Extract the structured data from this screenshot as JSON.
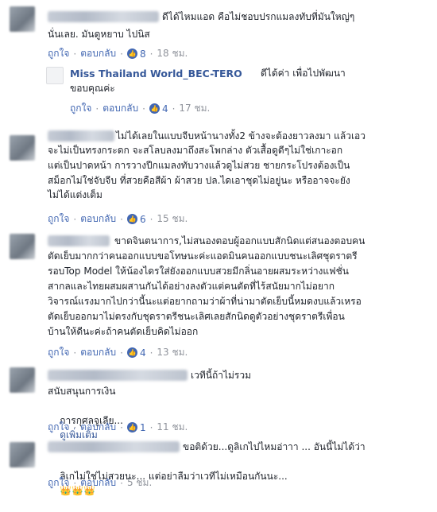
{
  "comments": [
    {
      "text_l1": "ดีได้ไหมแอด คือไม่ชอบปรกแมลงทับที่มันใหญ่ๆ",
      "text_l2": "นั่นเลย. มันดูหยาบ ไปนิส",
      "like": "ถูกใจ",
      "reply": "ตอบกลับ",
      "count": "8",
      "time": "18 ชม."
    },
    {
      "name": "Miss Thailand World_BEC-TERO",
      "text_l1": "ดีได้ค่า เพื่อไปพัฒนา",
      "text_l2": "ขอบคุณค่ะ",
      "like": "ถูกใจ",
      "reply": "ตอบกลับ",
      "count": "4",
      "time": "17 ชม."
    },
    {
      "lines": [
        "ไม่ได้เลยในแบบจีบหน้านางทั้ง2 ข้างจะต้องยาวลงมา แล้วเอว",
        "จะไม่เป็นทรงกระดก จะสโลบลงมาถึงสะโพกล่าง ตัวเสื้อดูดีๆไม่ใช่เกาะอก",
        "แต่เป็นปาดหน้า การวางปีกแมลงทับวางแล้วดูไม่สวย ชายกระโปรงต้องเป็น",
        "สม็อกไม่ใช่จับจีบ ที่สวยคือสีผ้า ผ้าสวย ปล.ไดเอาชุดไม่อยู่นะ หรืออาจจะยัง",
        "ไม่ได้แต่งเต็ม"
      ],
      "like": "ถูกใจ",
      "reply": "ตอบกลับ",
      "count": "6",
      "time": "15 ชม."
    },
    {
      "lines": [
        "ขาดจินตนาการ,ไม่สนองตอบผู้ออกแบบสักนิดแต่สนองตอบคน",
        "ตัดเย็บมากกว่าคนออกแบบขอโทษนะค่ะแอดมินคนออกแบบชนะเลิศชุดราตรี",
        "รอบTop Model ให้น้องไดรใส่ยังออกแบบสวยมีกลิ่นอายผสมระหว่างแฟชั่น",
        "สากลและไทยผสมผสานกันได้อย่างลงตัวแต่คนตัดที่ไร้สนัยมากไม่อยาก",
        "วิจารณ์แรงมากไปกว่านี้นะแต่อยากถามว่าผ้าที่น่ามาตัดเย็บนี้หมดงบแล้วเหรอ",
        "ตัดเย็บออกมาไม่ตรงกับชุดราตรีชนะเลิศเลยสักนิดดูตัวอย่างชุดราตรีเพื่อน",
        "บ้านให้ดีนะค่ะถ้าคนตัดเย็บคิดไม่ออก"
      ],
      "like": "ถูกใจ",
      "reply": "ตอบกลับ",
      "count": "4",
      "time": "13 ชม."
    },
    {
      "text_l1": "เวทีนี้ถ้าไม่รวม",
      "text_l2": "สนับสนุนการเงิน",
      "text_l3": "การกุศลจูเลีย...",
      "see_more": "ดูเพิ่มเติม",
      "like": "ถูกใจ",
      "reply": "ตอบกลับ",
      "count": "1",
      "time": "11 ชม."
    },
    {
      "text_l1": "ขอติด้วย...ดูลิเกไปไหมอ่าาา ... อันนี้ไม่ได้ว่า",
      "text_l2": "ลิเกไม่ใช่ไม่สวยนะ... แต่อย่าลืมว่าเวทีไม่เหมือนกันนะ...",
      "crowns": "👑👑👑",
      "like": "ถูกใจ",
      "reply": "ตอบกลับ",
      "time": "5 ชม."
    }
  ],
  "colors": {
    "link": "#4267b2",
    "name": "#365899",
    "meta": "#90949c",
    "text": "#1d2129"
  }
}
